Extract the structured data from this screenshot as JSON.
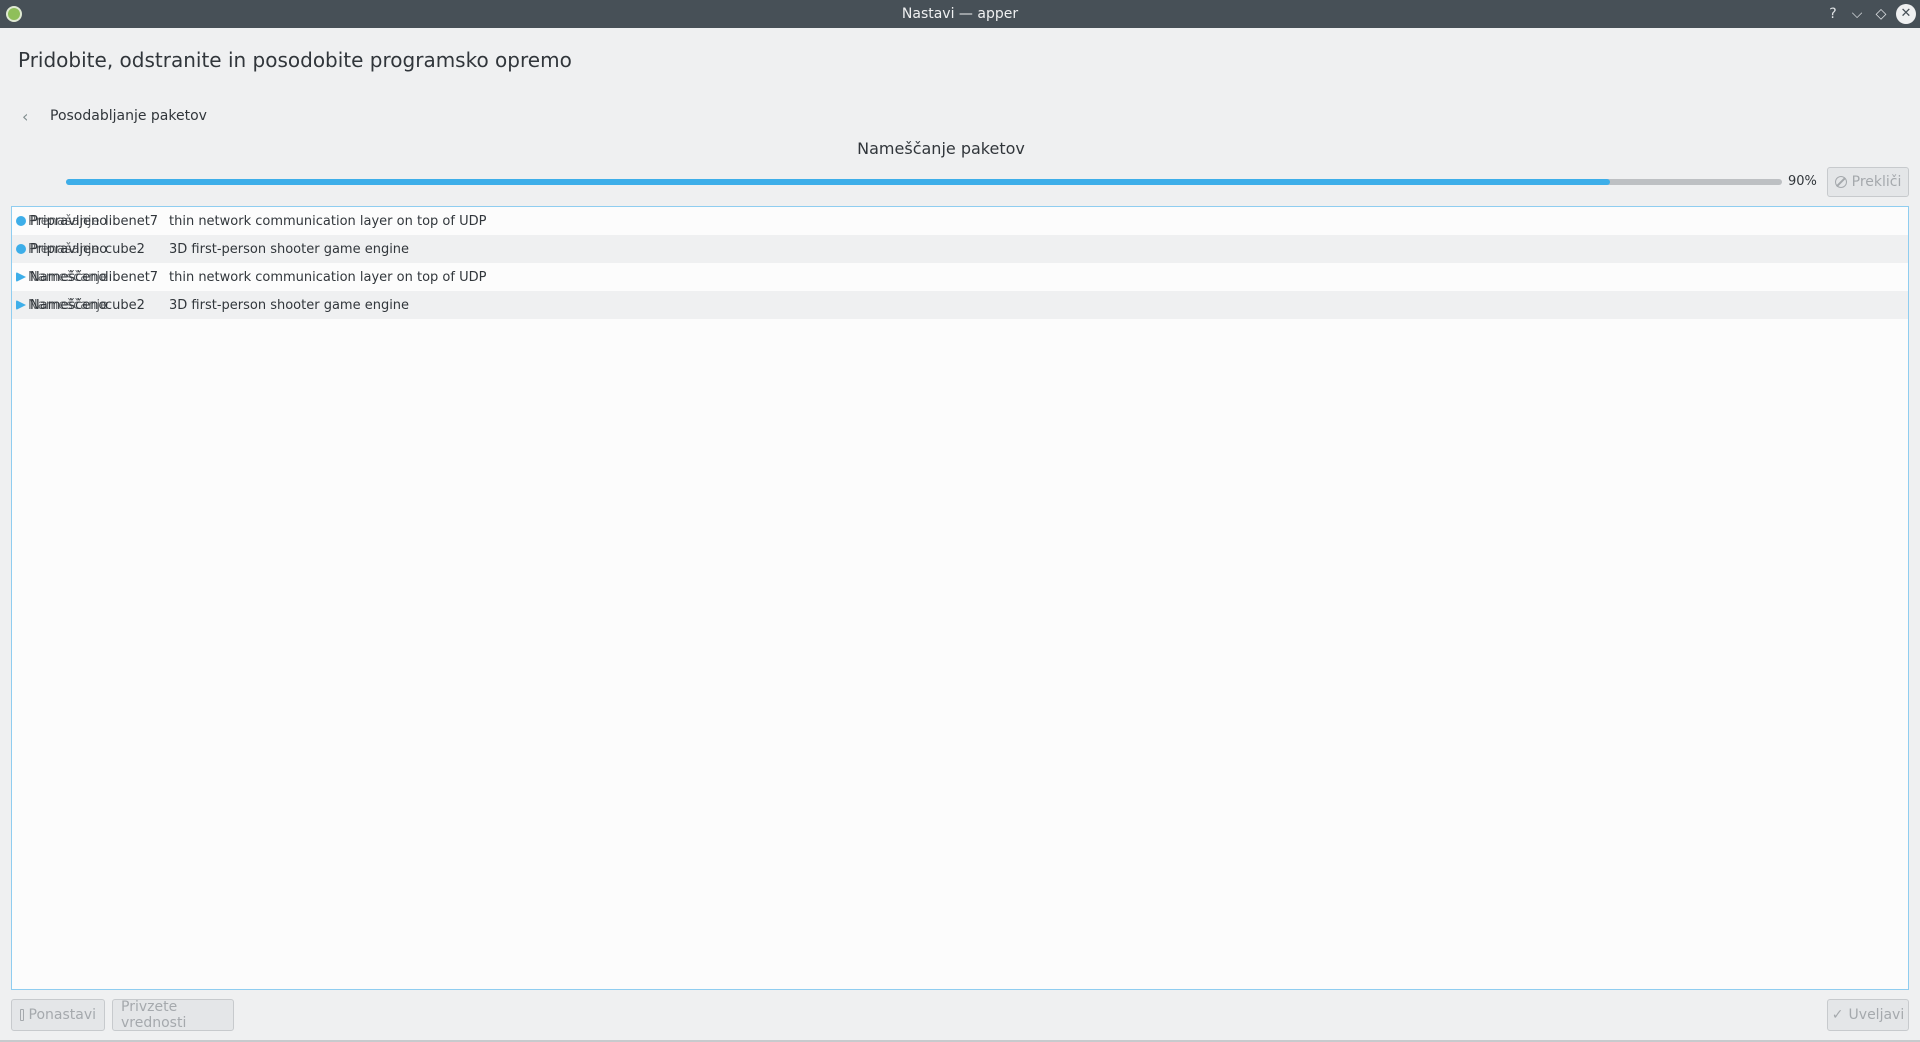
{
  "window": {
    "title": "Nastavi — apper",
    "help": "?",
    "minimize": "⌵",
    "maximize": "◇",
    "close": "✕"
  },
  "page": {
    "title": "Pridobite, odstranite in posodobite programsko opremo"
  },
  "nav": {
    "back_label": "Posodabljanje paketov"
  },
  "transaction": {
    "status": "Nameščanje paketov",
    "progress_percent": 90,
    "progress_label": "90%",
    "cancel_label": "Prekliči"
  },
  "packages": [
    {
      "status_ghost": "Prenašanje",
      "status": "Pripravljeno",
      "name": "libenet7",
      "description": "thin network communication layer on top of UDP",
      "icon": "download-icon"
    },
    {
      "status_ghost": "Prenašanje",
      "status": "Pripravljeno",
      "name": "cube2",
      "description": "3D first-person shooter game engine",
      "icon": "download-icon"
    },
    {
      "status_ghost": "Nameščanje",
      "status": "Nameščeno",
      "name": "libenet7",
      "description": "thin network communication layer on top of UDP",
      "icon": "install-icon"
    },
    {
      "status_ghost": "Nameščanje",
      "status": "Nameščeno",
      "name": "cube2",
      "description": "3D first-person shooter game engine",
      "icon": "install-icon"
    }
  ],
  "footer": {
    "reset_label": "Ponastavi",
    "defaults_label": "Privzete vrednosti",
    "apply_label": "Uveljavi"
  },
  "colors": {
    "accent": "#3daee9",
    "titlebar": "#475057",
    "background": "#eff0f1"
  }
}
